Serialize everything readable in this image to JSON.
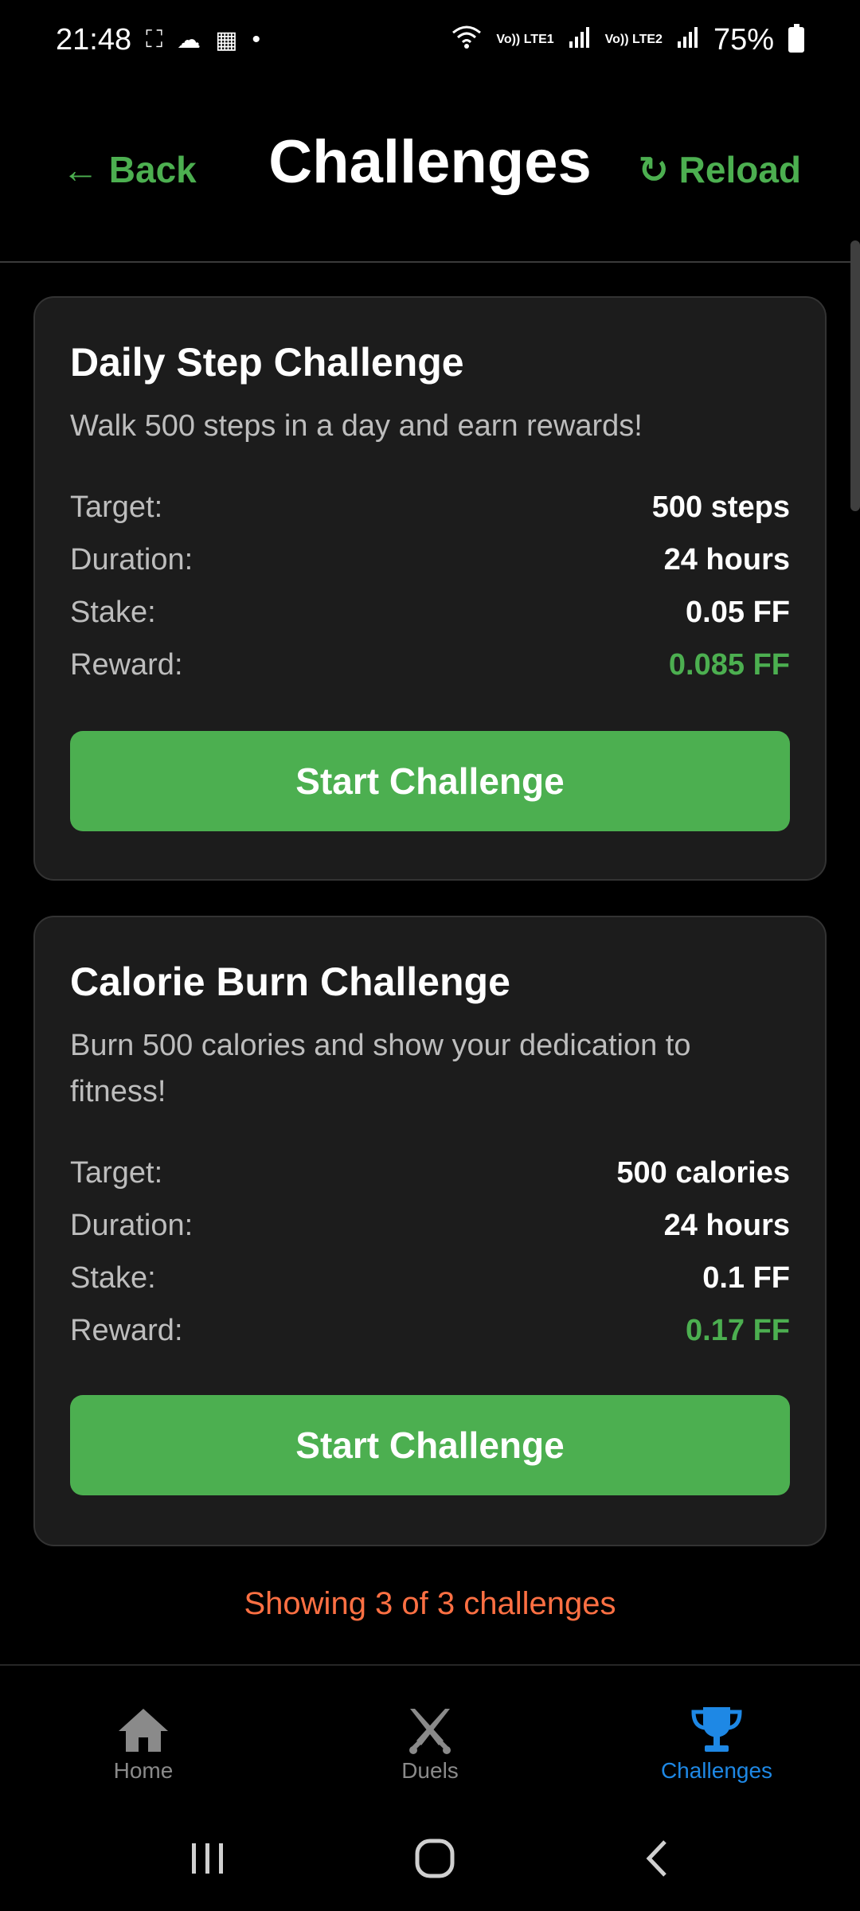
{
  "status_bar": {
    "time": "21:48",
    "battery_percent": "75%",
    "sim1_label": "Vo)) LTE1",
    "sim2_label": "Vo)) LTE2"
  },
  "header": {
    "back_label": "← Back",
    "title": "Challenges",
    "reload_label": "↻ Reload"
  },
  "challenges": [
    {
      "title": "Daily Step Challenge",
      "description": "Walk 500 steps in a day and earn rewards!",
      "target_label": "Target:",
      "target_value": "500 steps",
      "duration_label": "Duration:",
      "duration_value": "24 hours",
      "stake_label": "Stake:",
      "stake_value": "0.05 FF",
      "reward_label": "Reward:",
      "reward_value": "0.085 FF",
      "button_label": "Start Challenge"
    },
    {
      "title": "Calorie Burn Challenge",
      "description": "Burn 500 calories and show your dedication to fitness!",
      "target_label": "Target:",
      "target_value": "500 calories",
      "duration_label": "Duration:",
      "duration_value": "24 hours",
      "stake_label": "Stake:",
      "stake_value": "0.1 FF",
      "reward_label": "Reward:",
      "reward_value": "0.17 FF",
      "button_label": "Start Challenge"
    }
  ],
  "footer": {
    "showing_text": "Showing 3 of 3 challenges"
  },
  "bottom_nav": {
    "items": [
      {
        "label": "Home",
        "icon": "home-icon",
        "active": false
      },
      {
        "label": "Duels",
        "icon": "crossed-swords-icon",
        "active": false
      },
      {
        "label": "Challenges",
        "icon": "trophy-icon",
        "active": true
      }
    ]
  },
  "colors": {
    "accent_green": "#4caf50",
    "active_blue": "#1e88e5",
    "footer_orange": "#ff7043",
    "card_bg": "#1c1c1c"
  }
}
